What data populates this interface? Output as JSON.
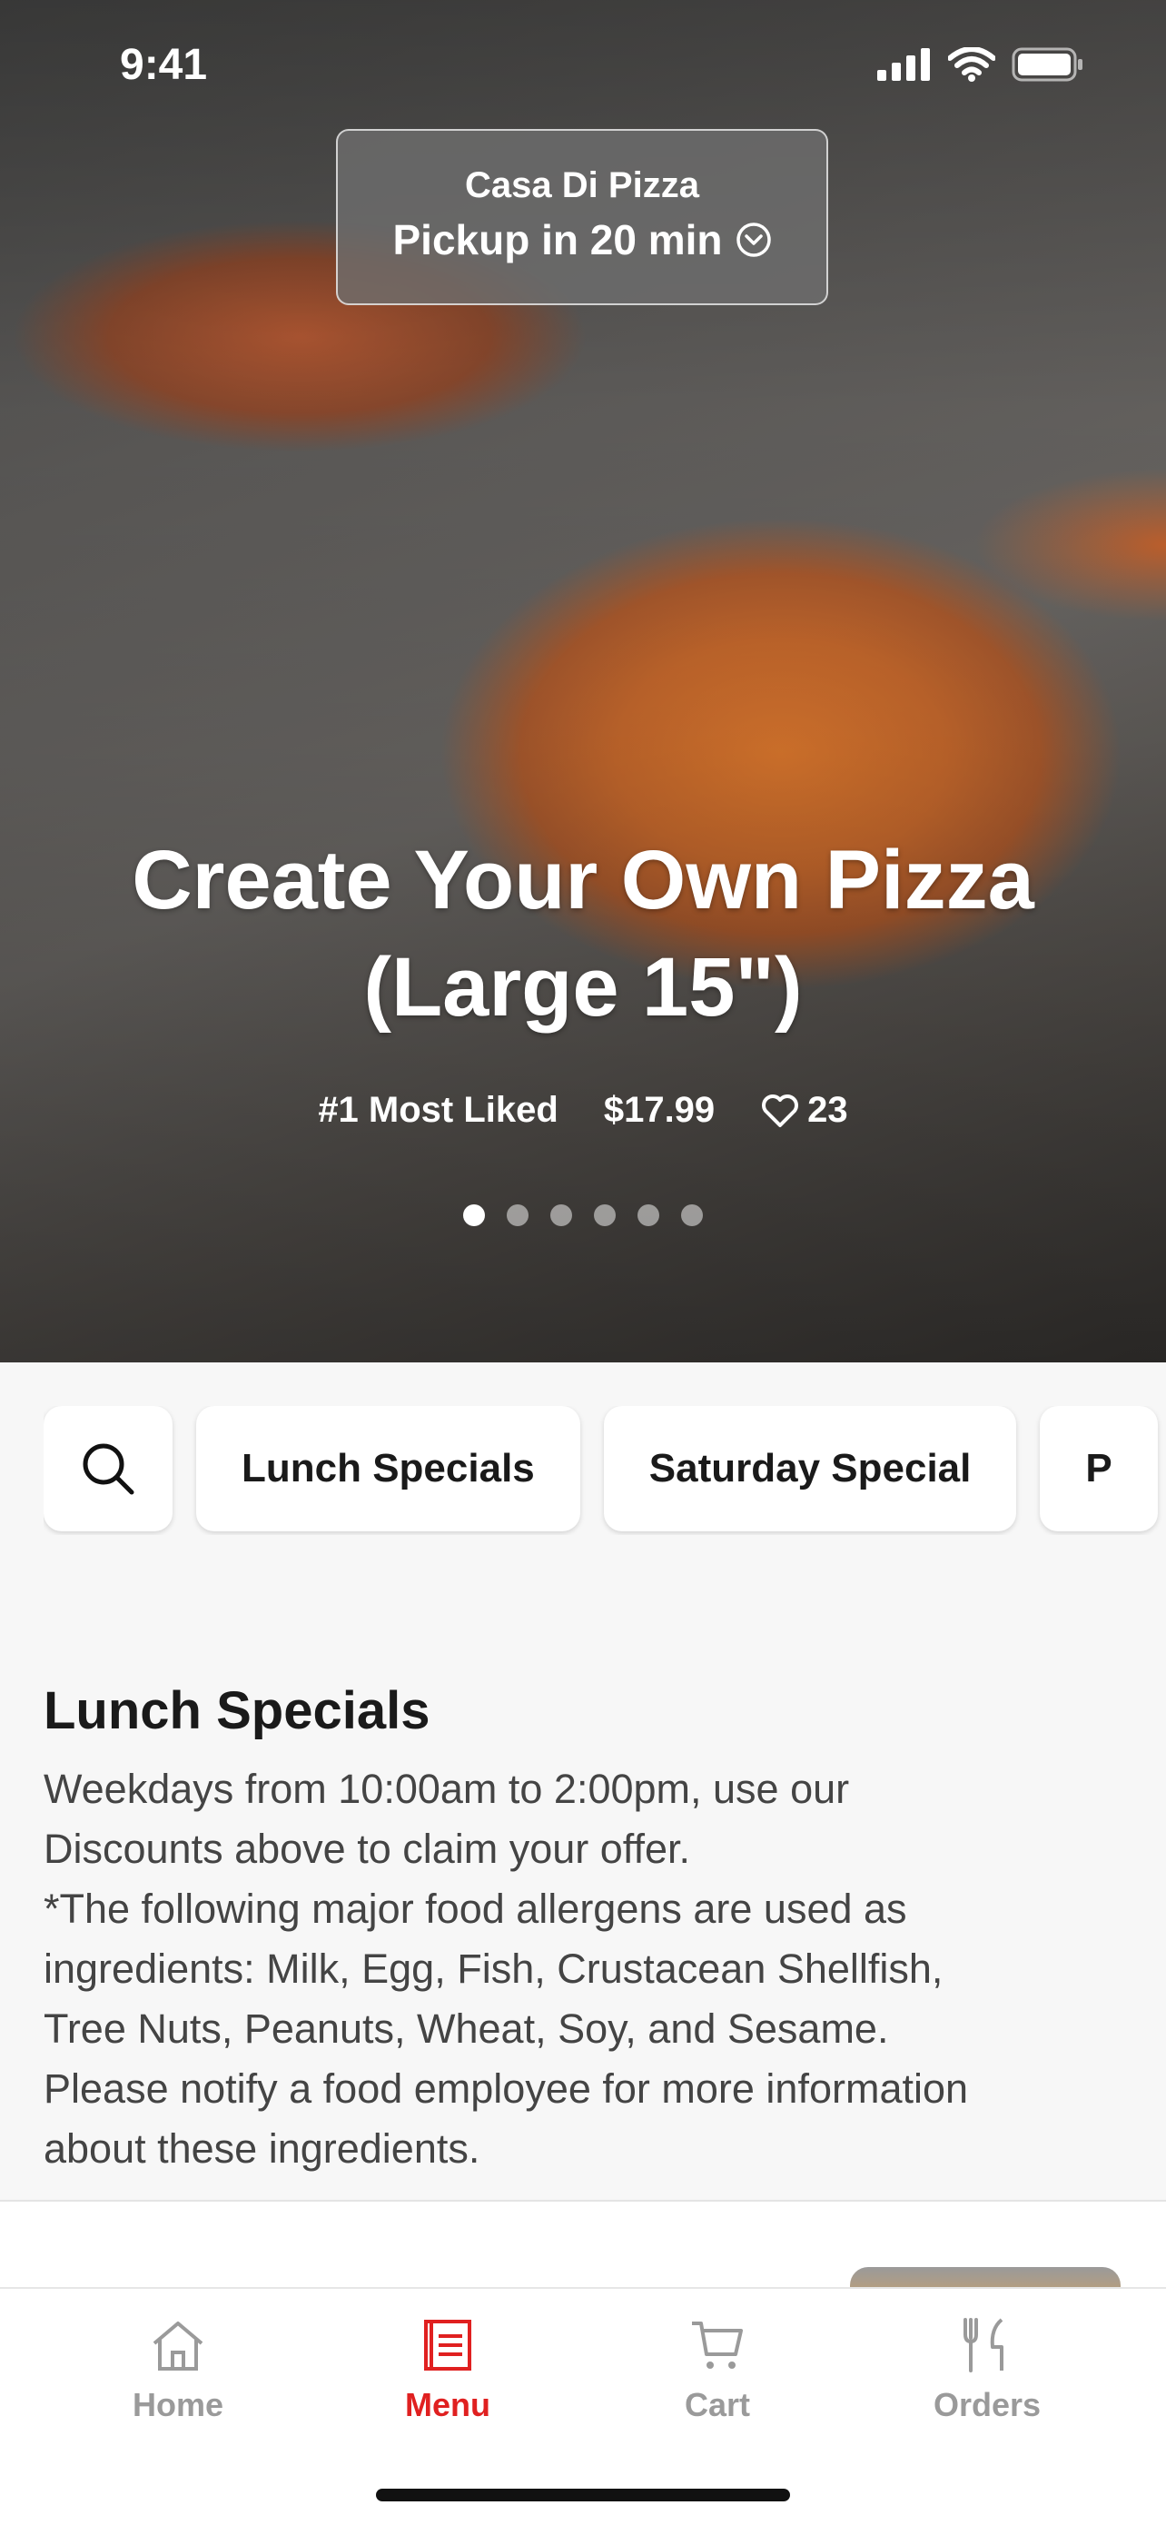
{
  "status_bar": {
    "time": "9:41"
  },
  "location": {
    "restaurant_name": "Casa Di Pizza",
    "pickup_text": "Pickup in 20 min"
  },
  "hero": {
    "title_line1": "Create Your Own Pizza",
    "title_line2": "(Large 15\")",
    "rank": "#1 Most Liked",
    "price": "$17.99",
    "likes": "23",
    "carousel_dots": 6,
    "active_dot": 1
  },
  "categories": {
    "search_icon": "search-icon",
    "items": [
      "Lunch Specials",
      "Saturday Special",
      "P"
    ]
  },
  "section": {
    "title": "Lunch Specials",
    "description": "Weekdays from 10:00am to 2:00pm, use our\nDiscounts above to claim your offer.\n*The following major food allergens are used as\ningredients: Milk, Egg, Fish, Crustacean Shellfish,\nTree Nuts, Peanuts, Wheat, Soy, and Sesame.\nPlease notify a food employee for more information\nabout these ingredients."
  },
  "tabbar": {
    "tabs": [
      {
        "label": "Home",
        "icon": "home-icon"
      },
      {
        "label": "Menu",
        "icon": "menu-icon"
      },
      {
        "label": "Cart",
        "icon": "cart-icon"
      },
      {
        "label": "Orders",
        "icon": "utensils-icon"
      }
    ],
    "active": "Menu"
  },
  "colors": {
    "accent": "#e02020",
    "inactive": "#9a9a9a"
  }
}
